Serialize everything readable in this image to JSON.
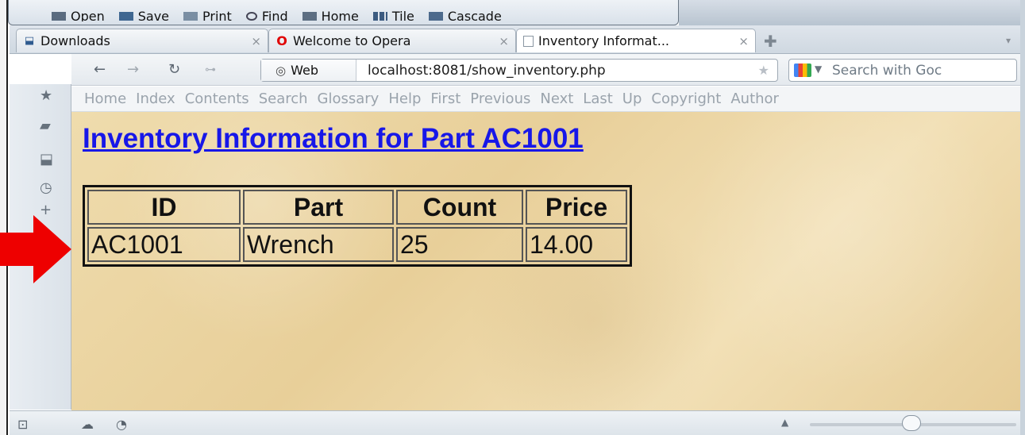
{
  "toolbar": {
    "items": [
      {
        "label": "Open",
        "icon": "open-icon"
      },
      {
        "label": "Save",
        "icon": "save-icon"
      },
      {
        "label": "Print",
        "icon": "print-icon"
      },
      {
        "label": "Find",
        "icon": "find-icon"
      },
      {
        "label": "Home",
        "icon": "home-icon"
      },
      {
        "label": "Tile",
        "icon": "tile-icon"
      },
      {
        "label": "Cascade",
        "icon": "cascade-icon"
      }
    ]
  },
  "tabs": [
    {
      "label": "Downloads",
      "icon": "downloads-icon",
      "active": false
    },
    {
      "label": "Welcome to Opera",
      "icon": "opera-icon",
      "active": false
    },
    {
      "label": "Inventory Informat...",
      "icon": "page-icon",
      "active": true
    }
  ],
  "address": {
    "badge": "Web",
    "url": "localhost:8081/show_inventory.php",
    "search_placeholder": "Search with Goc"
  },
  "navlinks": [
    "Home",
    "Index",
    "Contents",
    "Search",
    "Glossary",
    "Help",
    "First",
    "Previous",
    "Next",
    "Last",
    "Up",
    "Copyright",
    "Author"
  ],
  "page": {
    "title": "Inventory Information for Part AC1001",
    "table": {
      "headers": [
        "ID",
        "Part",
        "Count",
        "Price"
      ],
      "rows": [
        [
          "AC1001",
          "Wrench",
          "25",
          "14.00"
        ]
      ]
    }
  },
  "colors": {
    "title_link": "#1717e8",
    "arrow": "#ee0000",
    "parchment": "#efdcad"
  }
}
